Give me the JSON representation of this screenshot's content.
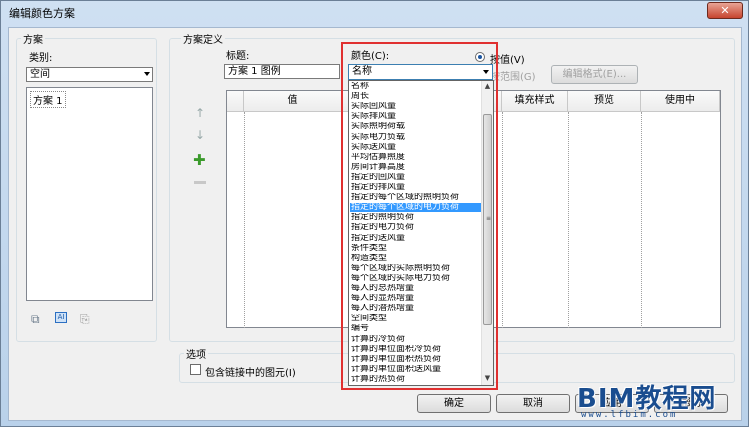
{
  "window": {
    "title": "编辑颜色方案",
    "close_label": "✕"
  },
  "scheme_group": {
    "label": "方案",
    "category_label": "类别:",
    "category_value": "空间",
    "items": [
      "方案 1"
    ]
  },
  "definition_group": {
    "label": "方案定义",
    "title_label": "标题:",
    "title_value": "方案 1 图例",
    "color_label": "颜色(C):",
    "color_value": "名称",
    "by_value_label": "按值(V)",
    "by_range_label": "按范围(G)",
    "edit_format_label": "编辑格式(E)...",
    "columns": [
      "值",
      "",
      "填充样式",
      "预览",
      "使用中"
    ]
  },
  "color_options": {
    "items": [
      "名称",
      "周长",
      "实际回风量",
      "实际排风量",
      "实际照明荷载",
      "实际电力负载",
      "实际送风量",
      "平均估算照度",
      "房间计算高度",
      "指定的回风量",
      "指定的排风量",
      "指定的每个区域的照明负荷",
      "指定的每个区域的电力负荷",
      "指定的照明负荷",
      "指定的电力负荷",
      "指定的送风量",
      "条件类型",
      "构造类型",
      "每个区域的实际照明负荷",
      "每个区域的实际电力负荷",
      "每人的总热增量",
      "每人的显热增量",
      "每人的潜热增量",
      "空间类型",
      "编号",
      "计算的冷负荷",
      "计算的单位面积冷负荷",
      "计算的单位面积热负荷",
      "计算的单位面积送风量",
      "计算的热负荷"
    ],
    "selected_index": 12
  },
  "options_group": {
    "label": "选项",
    "include_links_label": "包含链接中的图元(I)"
  },
  "buttons": {
    "ok": "确定",
    "cancel": "取消",
    "apply": "应用",
    "help": "帮助"
  },
  "watermark": {
    "big": "BIM教程网",
    "small": "www.lfbim.com"
  }
}
